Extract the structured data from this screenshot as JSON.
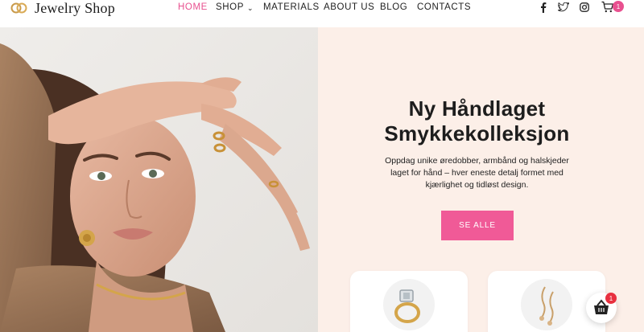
{
  "header": {
    "logo_text": "Jewelry Shop",
    "nav": [
      {
        "label": "HOME",
        "active": true
      },
      {
        "label": "SHOP",
        "has_dropdown": true
      },
      {
        "label": "MATERIALS"
      },
      {
        "label": "ABOUT US"
      },
      {
        "label": "BLOG"
      },
      {
        "label": "CONTACTS"
      }
    ],
    "social_icons": [
      "facebook-icon",
      "twitter-icon",
      "instagram-icon"
    ],
    "cart_count": "1"
  },
  "hero": {
    "title_line1": "Ny Håndlaget",
    "title_line2": "Smykkekolleksjon",
    "subtitle_line1": "Oppdag unike øredobber, armbånd og halskjeder",
    "subtitle_line2": "laget for hånd – hver eneste detalj formet med",
    "subtitle_line3": "kjærlighet og tidløst design.",
    "cta_label": "SE ALLE"
  },
  "floating_cart": {
    "count": "1"
  },
  "colors": {
    "accent": "#e8508f",
    "button": "#f05a97",
    "panel_bg": "#fcefe8",
    "badge_red": "#e8303f"
  }
}
